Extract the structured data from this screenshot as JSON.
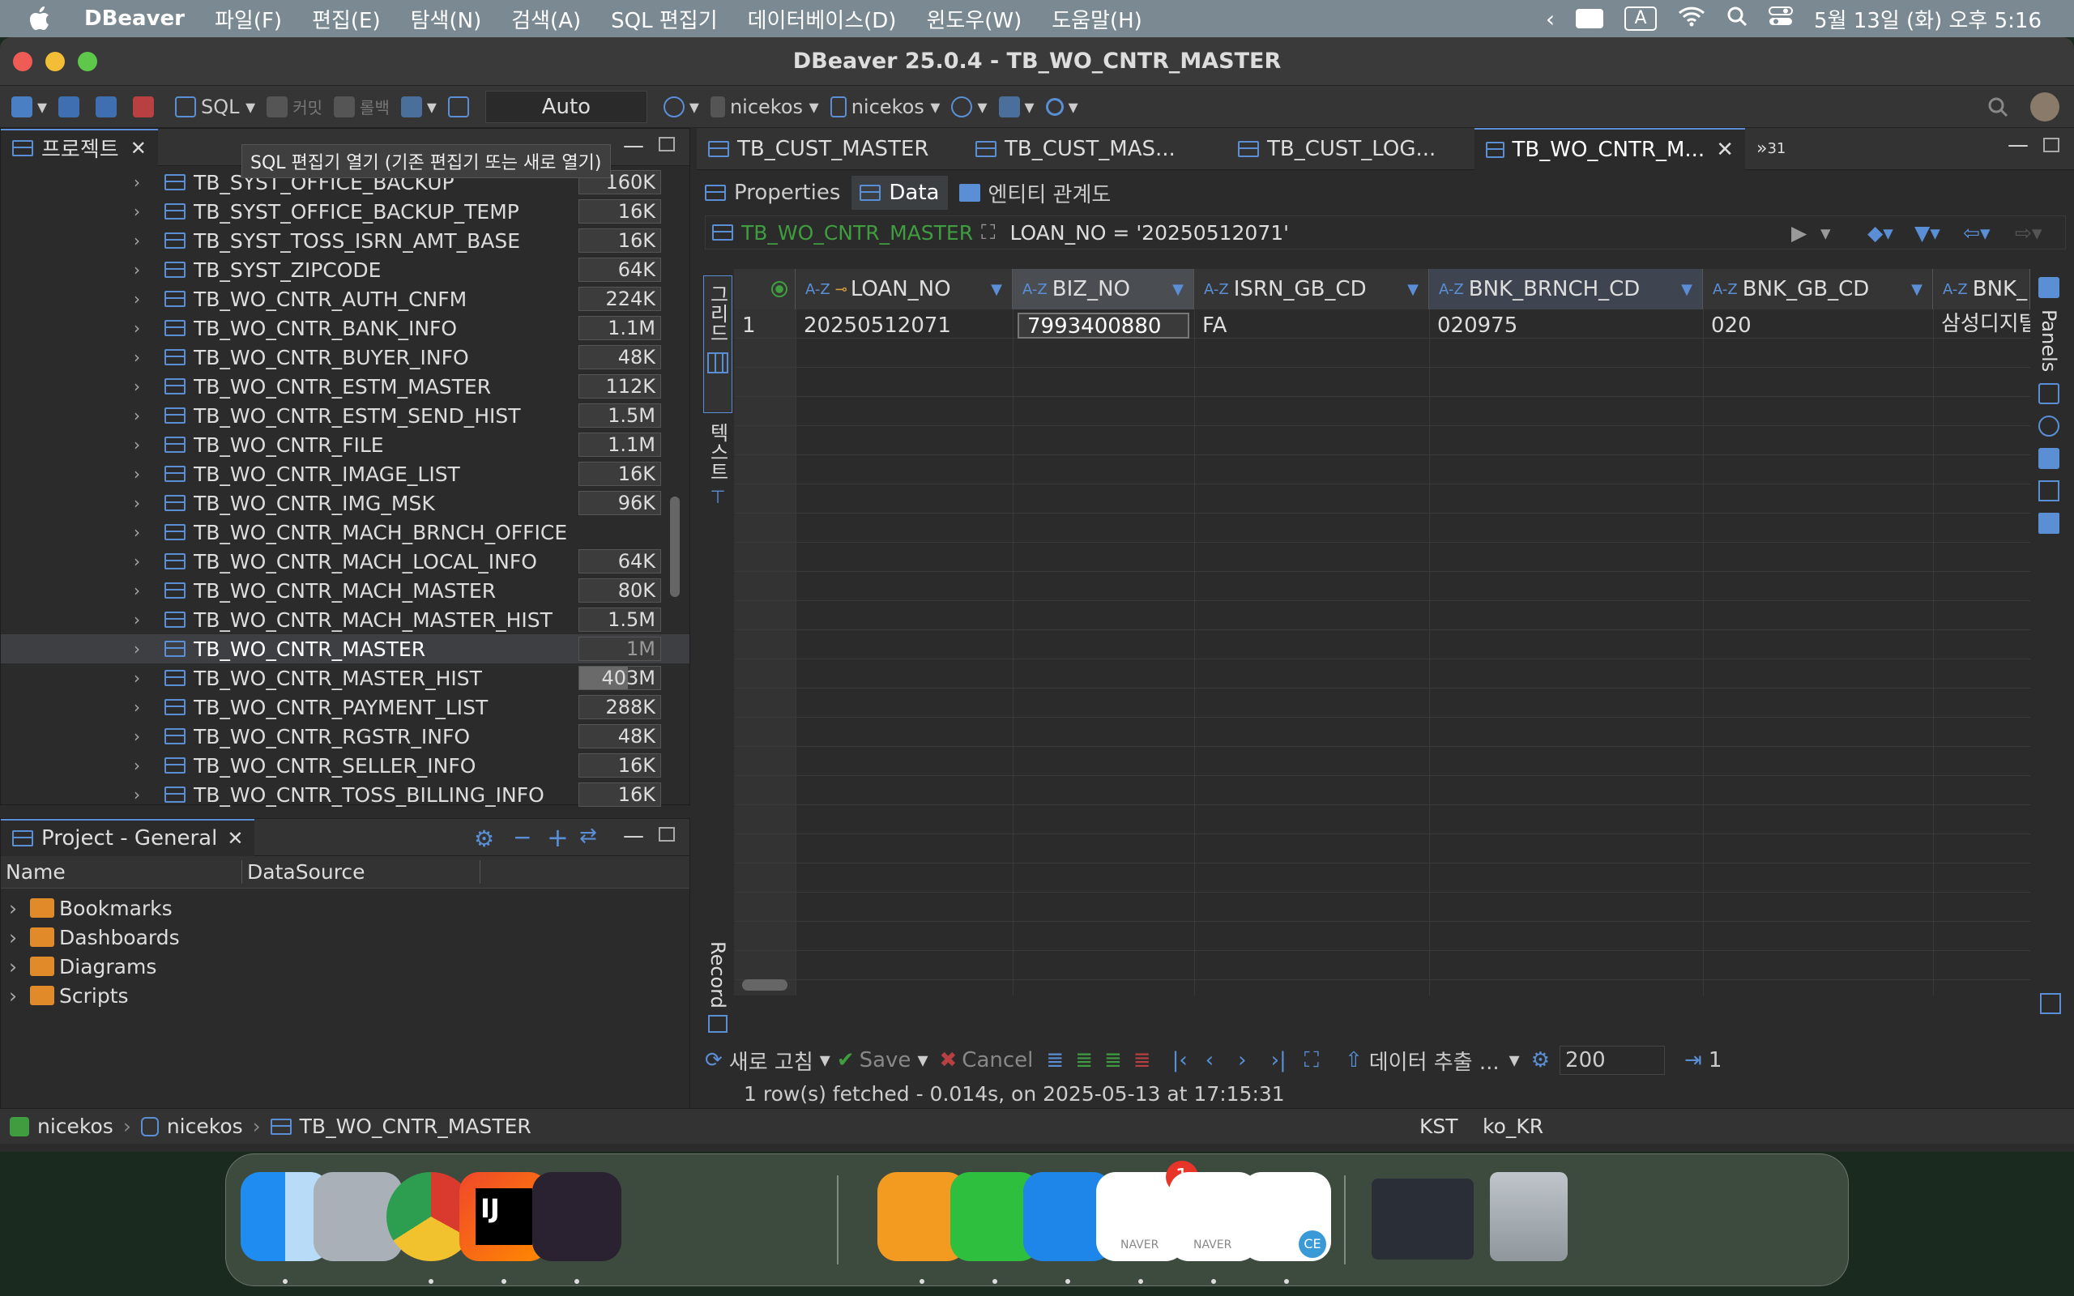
{
  "menubar": {
    "app": "DBeaver",
    "items": [
      "파일(F)",
      "편집(E)",
      "탐색(N)",
      "검색(A)",
      "SQL 편집기",
      "데이터베이스(D)",
      "윈도우(W)",
      "도움말(H)"
    ],
    "input_indicator": "A",
    "datetime": "5월 13일 (화) 오후 5:16"
  },
  "window": {
    "title": "DBeaver 25.0.4 - TB_WO_CNTR_MASTER"
  },
  "toolbar": {
    "sql_label": "SQL",
    "commit_label": "커밋",
    "rollback_label": "롤백",
    "tx_mode": "Auto",
    "datasource": "nicekos",
    "schema": "nicekos"
  },
  "tooltip": "SQL 편집기 열기 (기존 편집기 또는 새로 열기)",
  "project_panel": {
    "title": "프로젝트",
    "tables": [
      {
        "name": "TB_SYST_OFFICE_BACKUP",
        "size": "160K"
      },
      {
        "name": "TB_SYST_OFFICE_BACKUP_TEMP",
        "size": "16K"
      },
      {
        "name": "TB_SYST_TOSS_ISRN_AMT_BASE",
        "size": "16K"
      },
      {
        "name": "TB_SYST_ZIPCODE",
        "size": "64K"
      },
      {
        "name": "TB_WO_CNTR_AUTH_CNFM",
        "size": "224K"
      },
      {
        "name": "TB_WO_CNTR_BANK_INFO",
        "size": "1.1M"
      },
      {
        "name": "TB_WO_CNTR_BUYER_INFO",
        "size": "48K"
      },
      {
        "name": "TB_WO_CNTR_ESTM_MASTER",
        "size": "112K"
      },
      {
        "name": "TB_WO_CNTR_ESTM_SEND_HIST",
        "size": "1.5M"
      },
      {
        "name": "TB_WO_CNTR_FILE",
        "size": "1.1M"
      },
      {
        "name": "TB_WO_CNTR_IMAGE_LIST",
        "size": "16K"
      },
      {
        "name": "TB_WO_CNTR_IMG_MSK",
        "size": "96K"
      },
      {
        "name": "TB_WO_CNTR_MACH_BRNCH_OFFICE",
        "size": ""
      },
      {
        "name": "TB_WO_CNTR_MACH_LOCAL_INFO",
        "size": "64K"
      },
      {
        "name": "TB_WO_CNTR_MACH_MASTER",
        "size": "80K"
      },
      {
        "name": "TB_WO_CNTR_MACH_MASTER_HIST",
        "size": "1.5M"
      },
      {
        "name": "TB_WO_CNTR_MASTER",
        "size": "1M"
      },
      {
        "name": "TB_WO_CNTR_MASTER_HIST",
        "size": "403M"
      },
      {
        "name": "TB_WO_CNTR_PAYMENT_LIST",
        "size": "288K"
      },
      {
        "name": "TB_WO_CNTR_RGSTR_INFO",
        "size": "48K"
      },
      {
        "name": "TB_WO_CNTR_SELLER_INFO",
        "size": "16K"
      },
      {
        "name": "TB_WO_CNTR_TOSS_BILLING_INFO",
        "size": "16K"
      }
    ]
  },
  "general_panel": {
    "title": "Project - General",
    "col_name": "Name",
    "col_datasource": "DataSource",
    "items": [
      "Bookmarks",
      "Dashboards",
      "Diagrams",
      "Scripts"
    ]
  },
  "editor": {
    "tabs": [
      "TB_CUST_MASTER",
      "TB_CUST_MAS...",
      "TB_CUST_LOG...",
      "TB_WO_CNTR_M..."
    ],
    "overflow_count": "31",
    "subtabs": [
      "Properties",
      "Data",
      "엔티티 관계도"
    ],
    "filter_table": "TB_WO_CNTR_MASTER",
    "filter_text": "LOAN_NO = '20250512071'",
    "vertical_tabs": {
      "grid": "그리드",
      "text": "텍스트",
      "record": "Record",
      "panels": "Panels"
    },
    "columns": [
      "LOAN_NO",
      "BIZ_NO",
      "ISRN_GB_CD",
      "BNK_BRNCH_CD",
      "BNK_GB_CD",
      "BNK_"
    ],
    "rows": [
      {
        "num": "1",
        "cells": [
          "20250512071",
          "7993400880",
          "FA",
          "020975",
          "020",
          "삼성디지털"
        ]
      }
    ]
  },
  "result_toolbar": {
    "refresh": "새로 고침",
    "save": "Save",
    "cancel": "Cancel",
    "export": "데이터 추출 ...",
    "fetch_size": "200",
    "count": "1",
    "status": "1 row(s) fetched - 0.014s, on 2025-05-13 at 17:15:31"
  },
  "statusbar": {
    "crumbs": [
      "nicekos",
      "nicekos",
      "TB_WO_CNTR_MASTER"
    ],
    "tz": "KST",
    "locale": "ko_KR"
  },
  "dock": {
    "badge": "1",
    "naver_label": "NAVER",
    "ij_label": "IJ",
    "ce_label": "CE"
  },
  "colors": {
    "accent": "#5a8fd6",
    "menubar": "#7b8a92",
    "panel": "#2b2b2b"
  }
}
